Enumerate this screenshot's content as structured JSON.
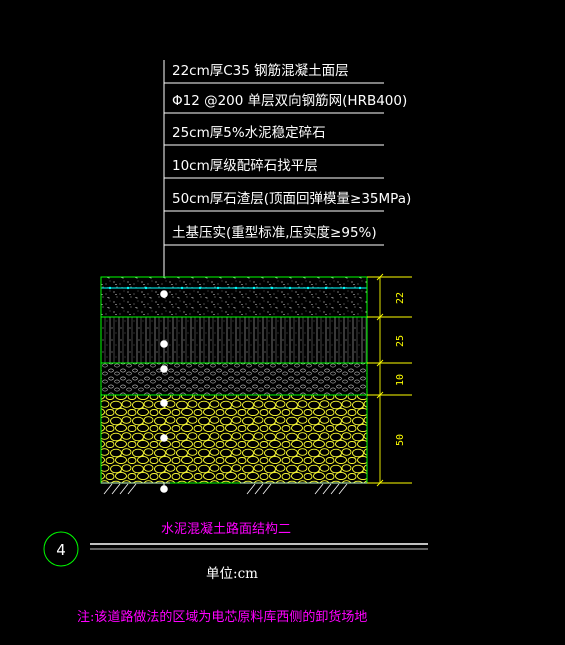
{
  "layer_labels": [
    "22cm厚C35 钢筋混凝土面层",
    "Φ12 @200 单层双向钢筋网(HRB400)",
    "25cm厚5%水泥稳定碎石",
    "10cm厚级配碎石找平层",
    "50cm厚石渣层(顶面回弹模量≥35MPa)",
    "土基压实(重型标准,压实度≥95%)"
  ],
  "dimensions": [
    "22",
    "25",
    "10",
    "50"
  ],
  "detail_number": "4",
  "detail_title": "水泥混凝土路面结构二",
  "unit_label": "单位:cm",
  "note": "注:该道路做法的区域为电芯原料库西侧的卸货场地",
  "colors": {
    "background": "#000000",
    "line": "#ffffff",
    "layer_outline": "#00ff00",
    "dimension": "#ffff00",
    "rebar": "#00ffff",
    "gravel_fill": "#ffff00",
    "title": "#ff00ff",
    "circle": "#00ff00"
  }
}
